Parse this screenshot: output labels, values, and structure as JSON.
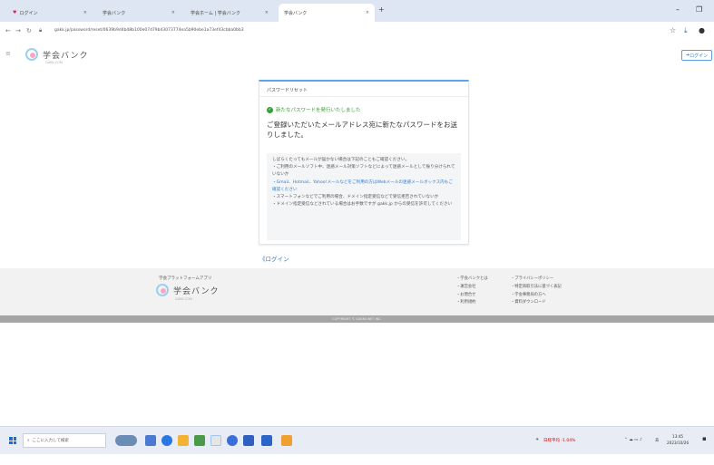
{
  "browser": {
    "tabs": [
      {
        "label": "ログイン",
        "active": false
      },
      {
        "label": "学会バンク",
        "active": false
      },
      {
        "label": "学会ホーム | 学会バンク",
        "active": false
      },
      {
        "label": "学会バンク",
        "active": true
      }
    ],
    "new_tab": "+",
    "minimize": "–",
    "restore": "❐",
    "url": "gakk.jp/password/reset/0639b9d4b48b100e07d79b43073774ea5b90ebe1a73ef43cbba0bb3"
  },
  "site": {
    "logo_text": "学会バンク",
    "logo_sub": "GAKK.COM",
    "login_button": "ログイン"
  },
  "card": {
    "title": "パスワードリセット",
    "success_message": "新たなパスワードを発行いたしました",
    "main_message": "ご登録いただいたメールアドレス宛に新たなパスワードをお送りしました。",
    "notes": [
      "しばらくたってもメールが届かない場合は下記のこともご確認ください。",
      "・ご利用のメールソフト中、迷惑メール対策ソフトなどによって迷惑メールとして振り分けられていないか",
      "・Gmail、Hotmail、Yahoo!メールなどをご利用の方はWebメールの迷惑メールボックス内もご確認ください",
      "・スマートフォンなどでご利用の場合、ドメイン指定受信などで受信拒否されていないか",
      "・ドメイン指定受信などされている場合はお手数ですが gakk.jp からの受信を許可してください"
    ]
  },
  "back_link": "《ログイン",
  "footer": {
    "platform_label": "学会プラットフォームアプリ",
    "logo_text": "学会バンク",
    "logo_sub": "GAKK.COM",
    "col1": [
      "・学会バンクとは",
      "・運営会社",
      "・お問合せ",
      "・利用規約"
    ],
    "col2": [
      "・プライバシーポリシー",
      "・特定商取引法に基づく表記",
      "・学会事務局の方へ",
      "・資料ダウンロード"
    ],
    "copyright": "COPYRIGHT © GAKKO.NET INC."
  },
  "taskbar": {
    "search_placeholder": "ここに入力して検索",
    "weather": "日経平均 -1.04%",
    "time": "13:45",
    "date": "2023/10/26",
    "lang": "あ"
  }
}
